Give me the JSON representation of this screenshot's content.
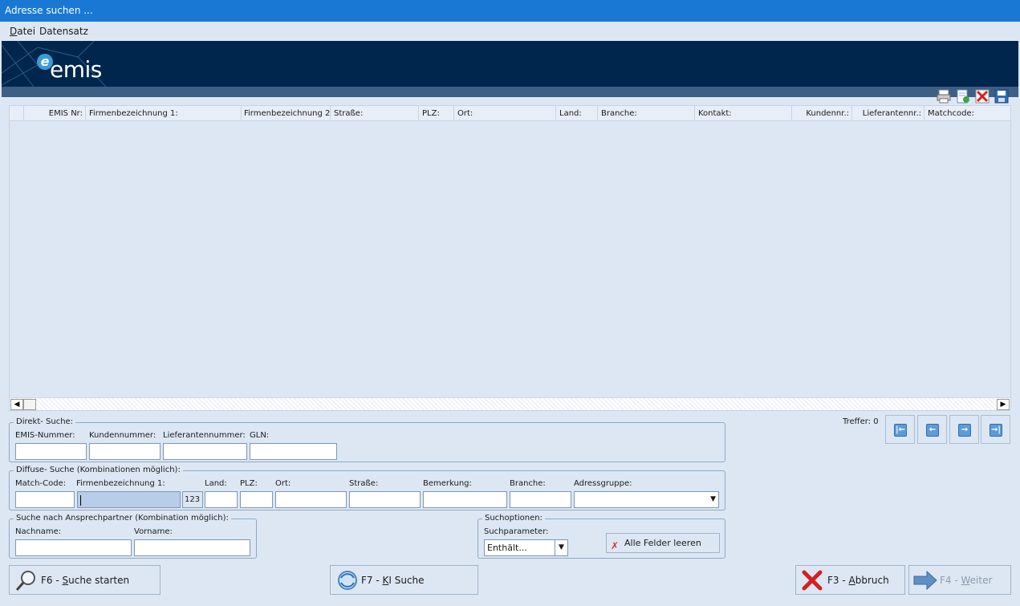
{
  "window": {
    "title": "Adresse suchen ..."
  },
  "menu": {
    "items": [
      {
        "u": "D",
        "rest": "atei"
      },
      {
        "u": "",
        "rest": "Datensatz"
      }
    ]
  },
  "logo": {
    "text": "emis",
    "mark": "e"
  },
  "grid": {
    "columns": [
      "EMIS Nr:",
      "Firmenbezeichnung 1:",
      "Firmenbezeichnung 2:",
      "Straße:",
      "PLZ:",
      "Ort:",
      "Land:",
      "Branche:",
      "Kontakt:",
      "Kundennr.:",
      "Lieferantennr.:",
      "Matchcode:"
    ]
  },
  "treffer": "Treffer: 0",
  "direkt": {
    "legend": "Direkt- Suche:",
    "labels": [
      "EMIS-Nummer:",
      "Kundennummer:",
      "Lieferantennummer:",
      "GLN:"
    ]
  },
  "diffuse": {
    "legend": "Diffuse- Suche (Kombinationen möglich):",
    "labels": [
      "Match-Code:",
      "Firmenbezeichnung 1:",
      "Land:",
      "PLZ:",
      "Ort:",
      "Straße:",
      "Bemerkung:",
      "Branche:",
      "Adressgruppe:"
    ],
    "num_badge": "123"
  },
  "ansprech": {
    "legend": "Suche nach Ansprechpartner (Kombination möglich):",
    "labels": [
      "Nachname:",
      "Vorname:"
    ]
  },
  "optionen": {
    "legend": "Suchoptionen:",
    "param_label": "Suchparameter:",
    "param_value": "Enthält...",
    "clear_label": "Alle Felder leeren"
  },
  "buttons": {
    "start": {
      "pre": "F6 - ",
      "u": "S",
      "post": "uche starten"
    },
    "ki": {
      "pre": "F7 - ",
      "u": "K",
      "post": "I Suche"
    },
    "abbruch": {
      "pre": "F3 - ",
      "u": "A",
      "post": "bbruch"
    },
    "weiter": {
      "pre": "F4 - ",
      "u": "W",
      "post": "eiter"
    }
  },
  "colors": {
    "titlebar": "#1878d4",
    "banner": "#00264d",
    "background": "#dde7f3"
  }
}
